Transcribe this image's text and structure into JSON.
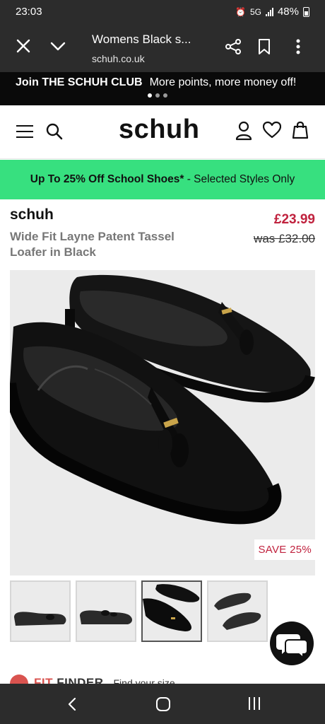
{
  "status_bar": {
    "time": "23:03",
    "network": "5G",
    "battery": "48%"
  },
  "browser": {
    "title": "Womens Black s...",
    "url": "schuh.co.uk"
  },
  "club_banner": {
    "title": "Join THE SCHUH CLUB",
    "subtitle": "More points, more money off!"
  },
  "site": {
    "logo": "schuh"
  },
  "promo": {
    "bold": "Up To 25% Off School Shoes*",
    "rest": " - Selected Styles Only"
  },
  "product": {
    "brand": "schuh",
    "name": "Wide Fit Layne Patent Tassel Loafer in Black",
    "price": "£23.99",
    "was_price": "was £32.00",
    "save_badge": "SAVE 25%"
  },
  "fit_finder": {
    "label_a": "FIT",
    "label_b": " FINDER",
    "sub": "Find your size"
  },
  "colors": {
    "promo_green": "#37e07f",
    "price_red": "#c0223e",
    "dark_bar": "#2c2c2c"
  },
  "thumbnails": {
    "count": 4,
    "selected_index": 2
  }
}
